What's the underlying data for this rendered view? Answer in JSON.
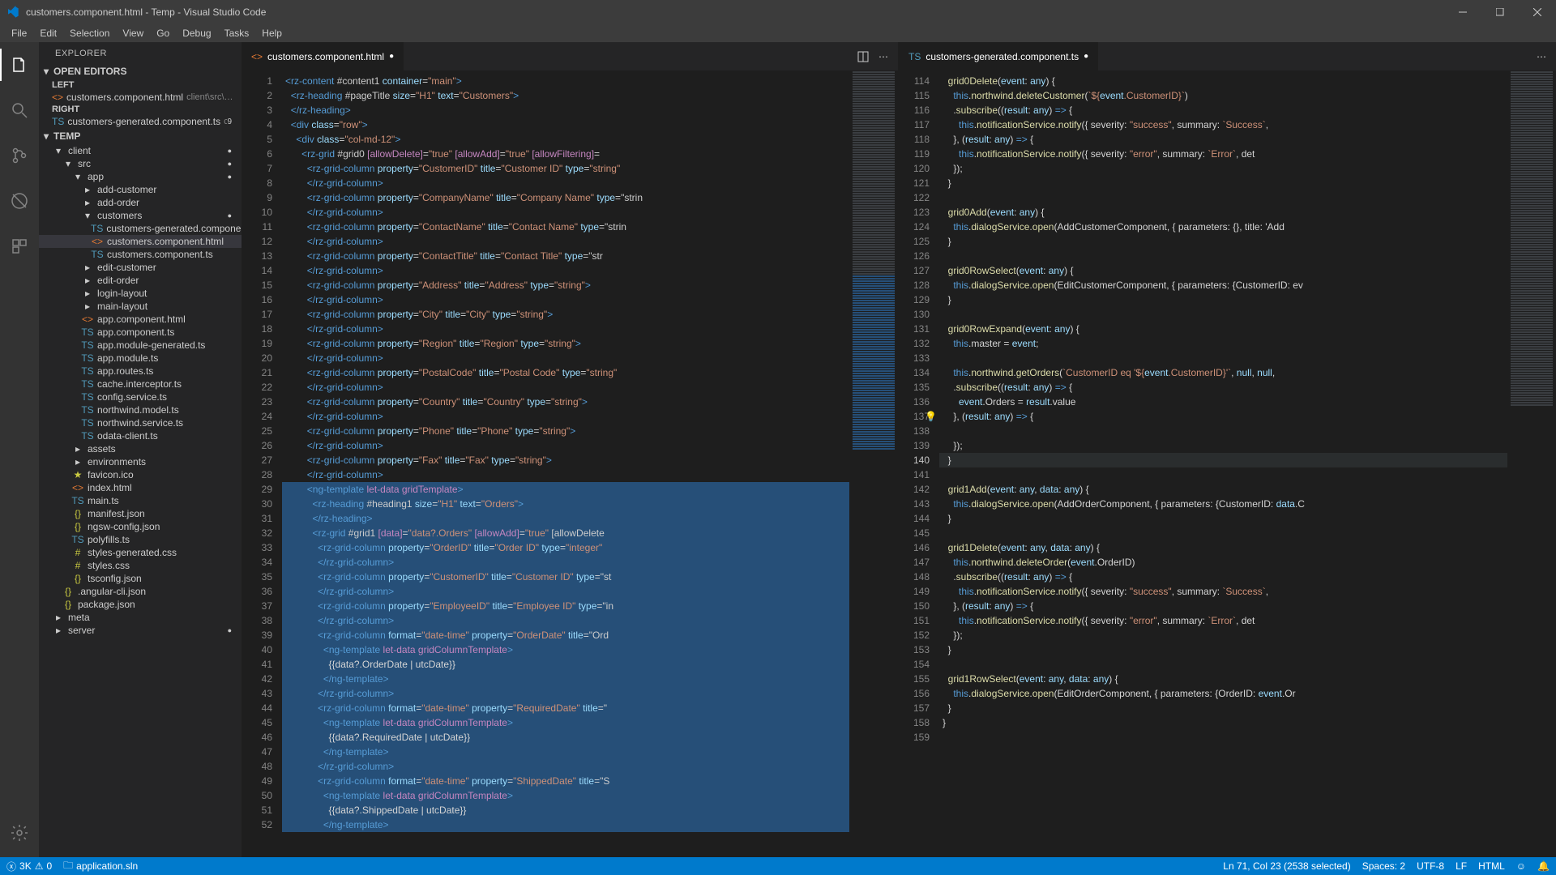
{
  "title": "customers.component.html - Temp - Visual Studio Code",
  "menu": [
    "File",
    "Edit",
    "Selection",
    "View",
    "Go",
    "Debug",
    "Tasks",
    "Help"
  ],
  "sidebar": {
    "title": "EXPLORER",
    "sections": {
      "open_editors": "OPEN EDITORS",
      "left": "LEFT",
      "right": "RIGHT",
      "temp": "TEMP"
    },
    "open_editors": {
      "left_file": "customers.component.html",
      "left_desc": "client\\src\\app\\cust...",
      "right_file": "customers-generated.component.ts",
      "right_desc": "clien...",
      "right_badge": "9"
    },
    "tree": [
      {
        "indent": 1,
        "kind": "folder",
        "open": true,
        "label": "client",
        "mod": true
      },
      {
        "indent": 2,
        "kind": "folder",
        "open": true,
        "label": "src",
        "mod": true
      },
      {
        "indent": 3,
        "kind": "folder",
        "open": true,
        "label": "app",
        "mod": true
      },
      {
        "indent": 4,
        "kind": "folder",
        "open": false,
        "label": "add-customer"
      },
      {
        "indent": 4,
        "kind": "folder",
        "open": false,
        "label": "add-order"
      },
      {
        "indent": 4,
        "kind": "folder",
        "open": true,
        "label": "customers",
        "mod": true
      },
      {
        "indent": 5,
        "kind": "ts",
        "label": "customers-generated.component.ts",
        "badge": "9"
      },
      {
        "indent": 5,
        "kind": "html",
        "label": "customers.component.html",
        "selected": true
      },
      {
        "indent": 5,
        "kind": "ts",
        "label": "customers.component.ts"
      },
      {
        "indent": 4,
        "kind": "folder",
        "open": false,
        "label": "edit-customer"
      },
      {
        "indent": 4,
        "kind": "folder",
        "open": false,
        "label": "edit-order"
      },
      {
        "indent": 4,
        "kind": "folder",
        "open": false,
        "label": "login-layout"
      },
      {
        "indent": 4,
        "kind": "folder",
        "open": false,
        "label": "main-layout"
      },
      {
        "indent": 4,
        "kind": "html",
        "label": "app.component.html"
      },
      {
        "indent": 4,
        "kind": "ts",
        "label": "app.component.ts"
      },
      {
        "indent": 4,
        "kind": "ts",
        "label": "app.module-generated.ts"
      },
      {
        "indent": 4,
        "kind": "ts",
        "label": "app.module.ts"
      },
      {
        "indent": 4,
        "kind": "ts",
        "label": "app.routes.ts"
      },
      {
        "indent": 4,
        "kind": "ts",
        "label": "cache.interceptor.ts"
      },
      {
        "indent": 4,
        "kind": "ts",
        "label": "config.service.ts"
      },
      {
        "indent": 4,
        "kind": "ts",
        "label": "northwind.model.ts"
      },
      {
        "indent": 4,
        "kind": "ts",
        "label": "northwind.service.ts"
      },
      {
        "indent": 4,
        "kind": "ts",
        "label": "odata-client.ts"
      },
      {
        "indent": 3,
        "kind": "folder",
        "open": false,
        "label": "assets"
      },
      {
        "indent": 3,
        "kind": "folder",
        "open": false,
        "label": "environments"
      },
      {
        "indent": 3,
        "kind": "fav",
        "label": "favicon.ico"
      },
      {
        "indent": 3,
        "kind": "html",
        "label": "index.html"
      },
      {
        "indent": 3,
        "kind": "ts",
        "label": "main.ts"
      },
      {
        "indent": 3,
        "kind": "json",
        "label": "manifest.json"
      },
      {
        "indent": 3,
        "kind": "json",
        "label": "ngsw-config.json"
      },
      {
        "indent": 3,
        "kind": "ts",
        "label": "polyfills.ts"
      },
      {
        "indent": 3,
        "kind": "css",
        "label": "styles-generated.css"
      },
      {
        "indent": 3,
        "kind": "css",
        "label": "styles.css"
      },
      {
        "indent": 3,
        "kind": "json",
        "label": "tsconfig.json"
      },
      {
        "indent": 2,
        "kind": "json",
        "label": ".angular-cli.json"
      },
      {
        "indent": 2,
        "kind": "json",
        "label": "package.json"
      },
      {
        "indent": 1,
        "kind": "folder",
        "open": false,
        "label": "meta"
      },
      {
        "indent": 1,
        "kind": "folder",
        "open": false,
        "label": "server",
        "mod": true
      }
    ]
  },
  "tabs": {
    "left": {
      "name": "customers.component.html",
      "mod": true
    },
    "right": {
      "name": "customers-generated.component.ts",
      "mod": true
    }
  },
  "left_code": {
    "start": 1,
    "lines": [
      "<rz-content #content1 container=\"main\">",
      "  <rz-heading #pageTitle size=\"H1\" text=\"Customers\">",
      "  </rz-heading>",
      "  <div class=\"row\">",
      "    <div class=\"col-md-12\">",
      "      <rz-grid #grid0 [allowDelete]=\"true\" [allowAdd]=\"true\" [allowFiltering]=",
      "        <rz-grid-column property=\"CustomerID\" title=\"Customer ID\" type=\"string\"",
      "        </rz-grid-column>",
      "        <rz-grid-column property=\"CompanyName\" title=\"Company Name\" type=\"strin",
      "        </rz-grid-column>",
      "        <rz-grid-column property=\"ContactName\" title=\"Contact Name\" type=\"strin",
      "        </rz-grid-column>",
      "        <rz-grid-column property=\"ContactTitle\" title=\"Contact Title\" type=\"str",
      "        </rz-grid-column>",
      "        <rz-grid-column property=\"Address\" title=\"Address\" type=\"string\">",
      "        </rz-grid-column>",
      "        <rz-grid-column property=\"City\" title=\"City\" type=\"string\">",
      "        </rz-grid-column>",
      "        <rz-grid-column property=\"Region\" title=\"Region\" type=\"string\">",
      "        </rz-grid-column>",
      "        <rz-grid-column property=\"PostalCode\" title=\"Postal Code\" type=\"string\"",
      "        </rz-grid-column>",
      "        <rz-grid-column property=\"Country\" title=\"Country\" type=\"string\">",
      "        </rz-grid-column>",
      "        <rz-grid-column property=\"Phone\" title=\"Phone\" type=\"string\">",
      "        </rz-grid-column>",
      "        <rz-grid-column property=\"Fax\" title=\"Fax\" type=\"string\">",
      "        </rz-grid-column>",
      "        <ng-template let-data gridTemplate>",
      "          <rz-heading #heading1 size=\"H1\" text=\"Orders\">",
      "          </rz-heading>",
      "          <rz-grid #grid1 [data]=\"data?.Orders\" [allowAdd]=\"true\" [allowDelete",
      "            <rz-grid-column property=\"OrderID\" title=\"Order ID\" type=\"integer\"",
      "            </rz-grid-column>",
      "            <rz-grid-column property=\"CustomerID\" title=\"Customer ID\" type=\"st",
      "            </rz-grid-column>",
      "            <rz-grid-column property=\"EmployeeID\" title=\"Employee ID\" type=\"in",
      "            </rz-grid-column>",
      "            <rz-grid-column format=\"date-time\" property=\"OrderDate\" title=\"Ord",
      "              <ng-template let-data gridColumnTemplate>",
      "                {{data?.OrderDate | utcDate}}",
      "              </ng-template>",
      "            </rz-grid-column>",
      "            <rz-grid-column format=\"date-time\" property=\"RequiredDate\" title=\"",
      "              <ng-template let-data gridColumnTemplate>",
      "                {{data?.RequiredDate | utcDate}}",
      "              </ng-template>",
      "            </rz-grid-column>",
      "            <rz-grid-column format=\"date-time\" property=\"ShippedDate\" title=\"S",
      "              <ng-template let-data gridColumnTemplate>",
      "                {{data?.ShippedDate | utcDate}}",
      "              </ng-template>"
    ]
  },
  "right_code": {
    "start": 114,
    "current": 140,
    "lightbulb": 137,
    "lines": [
      "  grid0Delete(event: any) {",
      "    this.northwind.deleteCustomer(`${event.CustomerID}`)",
      "    .subscribe((result: any) => {",
      "      this.notificationService.notify({ severity: \"success\", summary: `Success`,",
      "    }, (result: any) => {",
      "      this.notificationService.notify({ severity: \"error\", summary: `Error`, det",
      "    });",
      "  }",
      "",
      "  grid0Add(event: any) {",
      "    this.dialogService.open(AddCustomerComponent, { parameters: {}, title: 'Add ",
      "  }",
      "",
      "  grid0RowSelect(event: any) {",
      "    this.dialogService.open(EditCustomerComponent, { parameters: {CustomerID: ev",
      "  }",
      "",
      "  grid0RowExpand(event: any) {",
      "    this.master = event;",
      "",
      "    this.northwind.getOrders(`CustomerID eq '${event.CustomerID}'`, null, null, ",
      "    .subscribe((result: any) => {",
      "      event.Orders = result.value",
      "    }, (result: any) => {",
      "",
      "    });",
      "  }",
      "",
      "  grid1Add(event: any, data: any) {",
      "    this.dialogService.open(AddOrderComponent, { parameters: {CustomerID: data.C",
      "  }",
      "",
      "  grid1Delete(event: any, data: any) {",
      "    this.northwind.deleteOrder(event.OrderID)",
      "    .subscribe((result: any) => {",
      "      this.notificationService.notify({ severity: \"success\", summary: `Success`,",
      "    }, (result: any) => {",
      "      this.notificationService.notify({ severity: \"error\", summary: `Error`, det",
      "    });",
      "  }",
      "",
      "  grid1RowSelect(event: any, data: any) {",
      "    this.dialogService.open(EditOrderComponent, { parameters: {OrderID: event.Or",
      "  }",
      "}",
      ""
    ]
  },
  "status": {
    "errors": "3K",
    "warnings": "0",
    "sln": "application.sln",
    "pos": "Ln 71, Col 23 (2538 selected)",
    "spaces": "Spaces: 2",
    "encoding": "UTF-8",
    "eol": "LF",
    "lang": "HTML"
  }
}
